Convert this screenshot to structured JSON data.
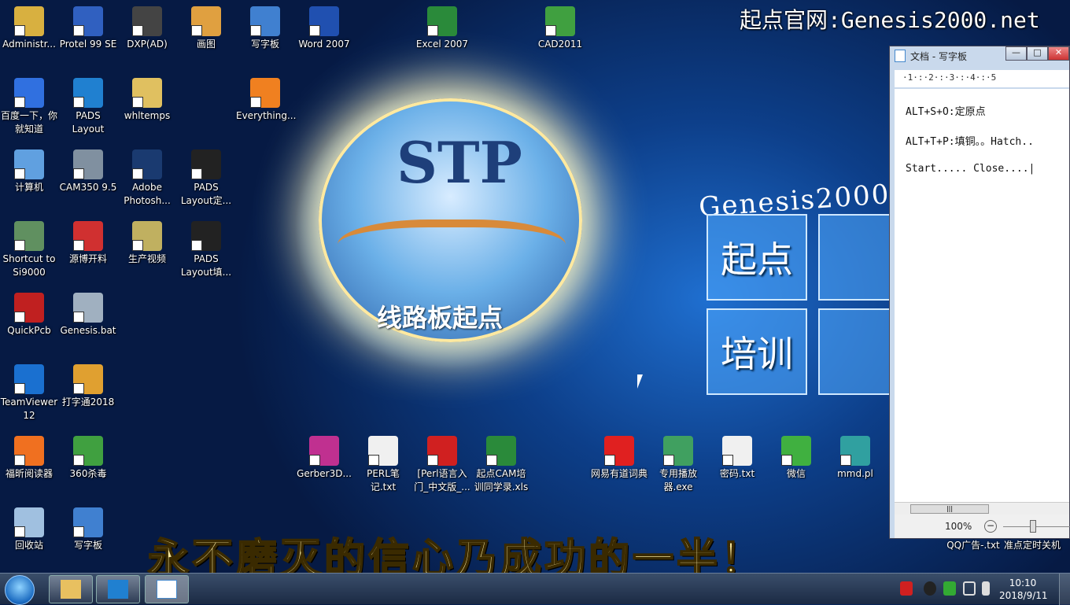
{
  "watermark": "起点官网:Genesis2000.net",
  "wallpaper": {
    "logo_text": "STP",
    "logo_cn": "线路板起点",
    "genesis_text": "Genesis2000.",
    "tiles": [
      "起点",
      "培训"
    ],
    "slogan": "永不磨灭的信心乃成功的一半！"
  },
  "icons": [
    {
      "label": "Administr...",
      "color": "#d8b040"
    },
    {
      "label": "Protel 99 SE",
      "color": "#3060c0"
    },
    {
      "label": "DXP(AD)",
      "color": "#444"
    },
    {
      "label": "画图",
      "color": "#e0a040"
    },
    {
      "label": "写字板",
      "color": "#4080d0"
    },
    {
      "label": "Word 2007",
      "color": "#2050b0"
    },
    {
      "label": "Excel 2007",
      "color": "#2a8a3a"
    },
    {
      "label": "CAD2011",
      "color": "#40a040"
    },
    {
      "label": "百度一下，你就知道",
      "color": "#3070e0"
    },
    {
      "label": "PADS Layout",
      "color": "#2080d0"
    },
    {
      "label": "whltemps",
      "color": "#e0c060"
    },
    {
      "label": "Everything...",
      "color": "#f08020"
    },
    {
      "label": "计算机",
      "color": "#60a0e0"
    },
    {
      "label": "CAM350 9.5",
      "color": "#8090a0"
    },
    {
      "label": "Adobe Photosh...",
      "color": "#1a3a70"
    },
    {
      "label": "PADS Layout定...",
      "color": "#222"
    },
    {
      "label": "Shortcut to Si9000",
      "color": "#609060"
    },
    {
      "label": "源博开料",
      "color": "#d03030"
    },
    {
      "label": "生产视频",
      "color": "#c0b060"
    },
    {
      "label": "PADS Layout填...",
      "color": "#222"
    },
    {
      "label": "QuickPcb",
      "color": "#c02020"
    },
    {
      "label": "Genesis.bat",
      "color": "#a0b0c0"
    },
    {
      "label": "TeamViewer 12",
      "color": "#1a70d0"
    },
    {
      "label": "打字通2018",
      "color": "#e0a030"
    },
    {
      "label": "福昕阅读器",
      "color": "#f07020"
    },
    {
      "label": "360杀毒",
      "color": "#40a040"
    },
    {
      "label": "Gerber3D...",
      "color": "#c03090"
    },
    {
      "label": "PERL笔记.txt",
      "color": "#f0f0f0"
    },
    {
      "label": "[Perl语言入门_中文版_...",
      "color": "#d02020"
    },
    {
      "label": "起点CAM培训同学录.xls",
      "color": "#2a8a3a"
    },
    {
      "label": "网易有道词典",
      "color": "#e02020"
    },
    {
      "label": "专用播放器.exe",
      "color": "#40a060"
    },
    {
      "label": "密码.txt",
      "color": "#f0f0f0"
    },
    {
      "label": "微信",
      "color": "#40b040"
    },
    {
      "label": "mmd.pl",
      "color": "#30a0a0"
    },
    {
      "label": "回收站",
      "color": "#a0c0e0"
    },
    {
      "label": "写字板",
      "color": "#4080d0"
    },
    {
      "label": "QQ广告-.txt",
      "color": "#f0f0f0"
    },
    {
      "label": "准点定时关机",
      "color": "#f0f0f0"
    }
  ],
  "wordpad": {
    "title": "文档 - 写字板",
    "ruler": "·1·:·2·:·3·:·4·:·5",
    "lines": [
      "ALT+S+O:定原点",
      "ALT+T+P:填铜。。Hatch..",
      "Start..... Close....|"
    ],
    "zoom": "100%",
    "zoom_out": "−",
    "minimize": "—",
    "maximize": "□",
    "close": "✕"
  },
  "taskbar": {
    "time": "10:10",
    "date": "2018/9/11"
  }
}
